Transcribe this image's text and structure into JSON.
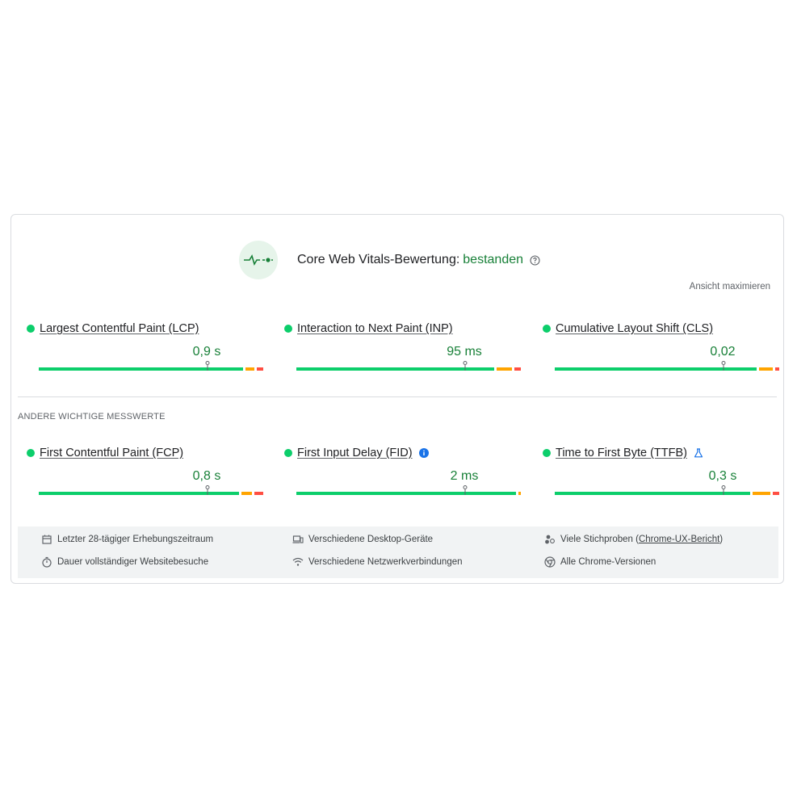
{
  "header": {
    "title": "Core Web Vitals-Bewertung:",
    "status": "bestanden",
    "expand_label": "Ansicht maximieren"
  },
  "colors": {
    "good": "#0cce6b",
    "needs_improvement": "#ffa400",
    "poor": "#ff4e42",
    "value_text": "#188038"
  },
  "core_metrics": [
    {
      "label": "Largest Contentful Paint (LCP)",
      "value": "0,9 s",
      "distribution": {
        "good": 0.93,
        "needs_improvement": 0.04,
        "poor": 0.03
      },
      "p75_position": 0.75
    },
    {
      "label": "Interaction to Next Paint (INP)",
      "value": "95 ms",
      "distribution": {
        "good": 0.9,
        "needs_improvement": 0.07,
        "poor": 0.03
      },
      "p75_position": 0.75
    },
    {
      "label": "Cumulative Layout Shift (CLS)",
      "value": "0,02",
      "distribution": {
        "good": 0.92,
        "needs_improvement": 0.06,
        "poor": 0.02
      },
      "p75_position": 0.75
    }
  ],
  "other_section_label": "ANDERE WICHTIGE MESSWERTE",
  "other_metrics": [
    {
      "label": "First Contentful Paint (FCP)",
      "value": "0,8 s",
      "distribution": {
        "good": 0.91,
        "needs_improvement": 0.05,
        "poor": 0.04
      },
      "p75_position": 0.75,
      "icon": ""
    },
    {
      "label": "First Input Delay (FID)",
      "value": "2 ms",
      "distribution": {
        "good": 0.99,
        "needs_improvement": 0.01,
        "poor": 0.0
      },
      "p75_position": 0.75,
      "icon": "info-icon"
    },
    {
      "label": "Time to First Byte (TTFB)",
      "value": "0,3 s",
      "distribution": {
        "good": 0.89,
        "needs_improvement": 0.08,
        "poor": 0.03
      },
      "p75_position": 0.75,
      "icon": "flask-icon"
    }
  ],
  "footer": {
    "collection_period": "Letzter 28-tägiger Erhebungszeitraum",
    "visit_duration": "Dauer vollständiger Websitebesuche",
    "devices": "Verschiedene Desktop-Geräte",
    "connections": "Verschiedene Netzwerkverbindungen",
    "samples_prefix": "Viele Stichproben (",
    "samples_link": "Chrome-UX-Bericht",
    "samples_suffix": ")",
    "chrome_versions": "Alle Chrome-Versionen"
  }
}
